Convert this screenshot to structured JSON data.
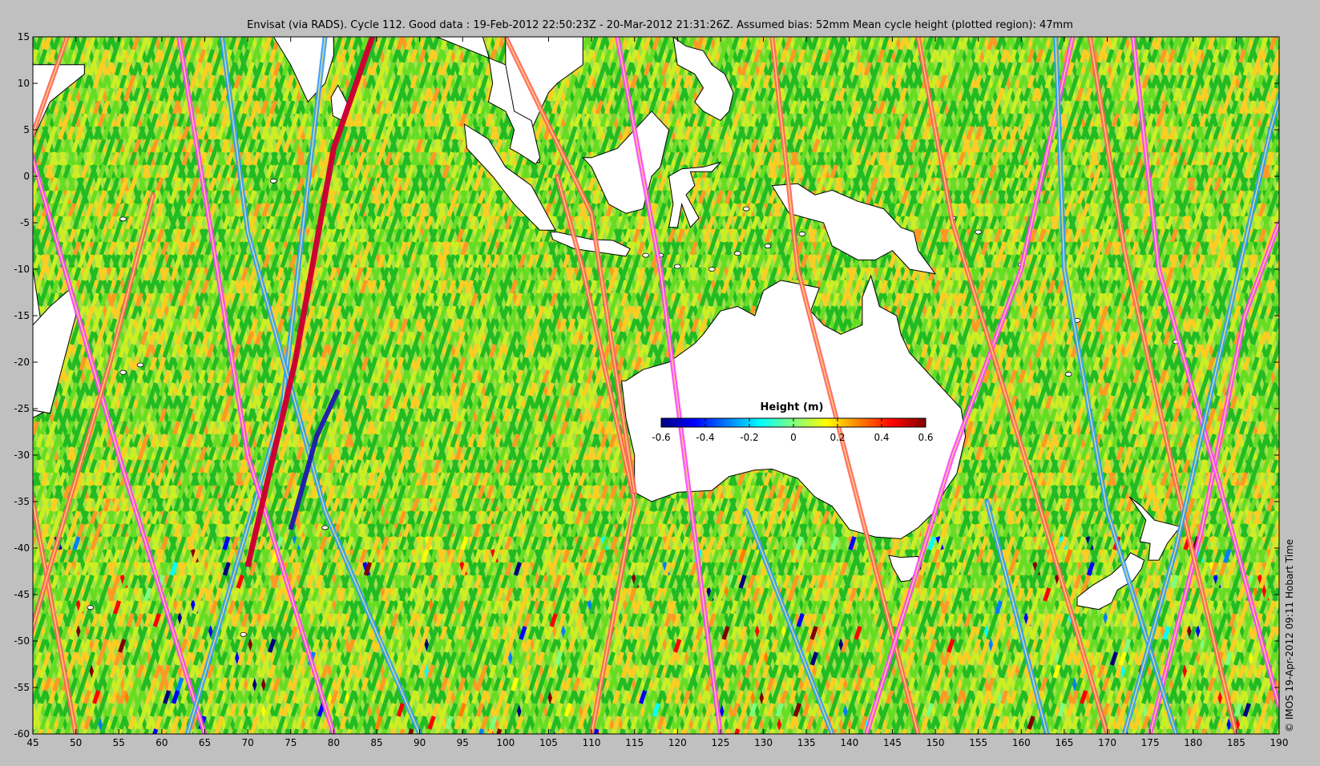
{
  "title": "Envisat (via RADS). Cycle 112. Good data : 19-Feb-2012 22:50:23Z - 20-Mar-2012 21:31:26Z. Assumed bias: 52mm  Mean cycle height (plotted region): 47mm",
  "credit": "© IMOS 19-Apr-2012 09:11 Hobart Time",
  "map": {
    "projection": "equirectangular",
    "lon_range": [
      45,
      190
    ],
    "lat_range": [
      -60,
      15
    ],
    "x_ticks": [
      "45",
      "50",
      "55",
      "60",
      "65",
      "70",
      "75",
      "80",
      "85",
      "90",
      "95",
      "100",
      "105",
      "110",
      "115",
      "120",
      "125",
      "130",
      "135",
      "140",
      "145",
      "150",
      "155",
      "160",
      "165",
      "170",
      "175",
      "180",
      "185",
      "190"
    ],
    "y_ticks": [
      "15",
      "10",
      "5",
      "0",
      "-5",
      "-10",
      "-15",
      "-20",
      "-25",
      "-30",
      "-35",
      "-40",
      "-45",
      "-50",
      "-55",
      "-60"
    ],
    "land_color": "#ffffff",
    "coastline_color": "#000000",
    "background_color": "#c0c0c0",
    "regions_shown": [
      "Africa (Horn, Madagascar)",
      "India",
      "Sri Lanka",
      "Southeast Asia",
      "Indonesia",
      "Papua New Guinea",
      "Australia",
      "Tasmania",
      "New Zealand"
    ]
  },
  "colorbar": {
    "label": "Height (m)",
    "ticks": [
      "-0.6",
      "-0.4",
      "-0.2",
      "0",
      "0.2",
      "0.4",
      "0.6"
    ],
    "range": [
      -0.6,
      0.6
    ],
    "colormap": [
      "#00007f",
      "#0000ff",
      "#007fff",
      "#00ffff",
      "#7fff7f",
      "#ffff00",
      "#ff7f00",
      "#ff0000",
      "#7f0000"
    ]
  },
  "dominant_track_colors": [
    "#22bb22",
    "#66dd22",
    "#ccee22",
    "#ffcc22",
    "#ff9922"
  ],
  "highlighted_tracks_color": [
    "#ff6060",
    "#ff40ff",
    "#3399ff",
    "#cc0033",
    "#2222aa"
  ]
}
